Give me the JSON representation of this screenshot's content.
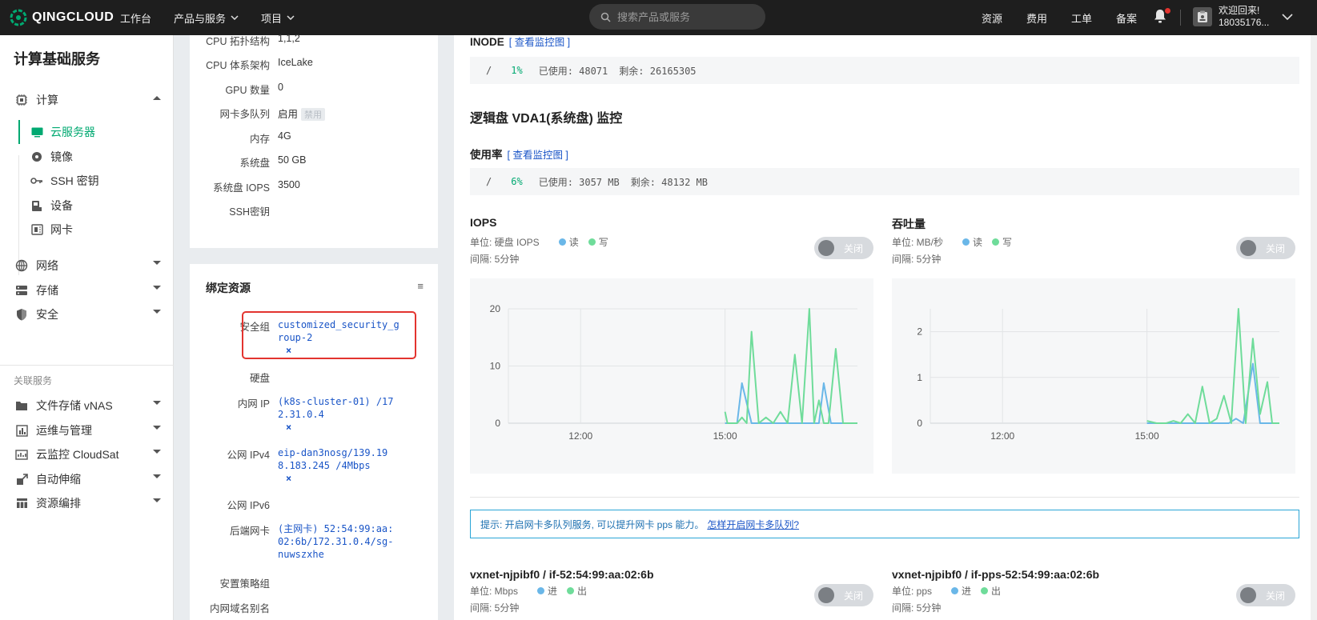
{
  "topbar": {
    "logo": "QINGCLOUD",
    "nav": [
      "工作台",
      "产品与服务",
      "项目"
    ],
    "search_placeholder": "搜索产品或服务",
    "right_nav": [
      "资源",
      "费用",
      "工单",
      "备案"
    ],
    "welcome": "欢迎回来!",
    "account": "18035176..."
  },
  "sidebar": {
    "title": "计算基础服务",
    "groups": {
      "compute": "计算",
      "network": "网络",
      "storage": "存储",
      "security": "安全"
    },
    "compute_items": [
      "云服务器",
      "镜像",
      "SSH 密钥",
      "设备",
      "网卡"
    ],
    "section_label": "关联服务",
    "related": [
      "文件存储 vNAS",
      "运维与管理",
      "云监控 CloudSat",
      "自动伸缩",
      "资源编排"
    ]
  },
  "spec": [
    {
      "k": "CPU 拓扑结构",
      "v": "1,1,2"
    },
    {
      "k": "CPU 体系架构",
      "v": "IceLake"
    },
    {
      "k": "GPU 数量",
      "v": "0"
    },
    {
      "k": "网卡多队列",
      "v": "启用",
      "tag": "禁用"
    },
    {
      "k": "内存",
      "v": "4G"
    },
    {
      "k": "系统盘",
      "v": "50 GB"
    },
    {
      "k": "系统盘 IOPS",
      "v": "3500"
    },
    {
      "k": "SSH密钥",
      "v": ""
    }
  ],
  "bound": {
    "title": "绑定资源",
    "menu": "≡",
    "security_group_k": "安全组",
    "security_group_v": "customized_security_group-2",
    "disk_k": "硬盘",
    "private_ip_k": "内网 IP",
    "private_ip_v": "(k8s-cluster-01) /172.31.0.4",
    "public_ipv4_k": "公网 IPv4",
    "public_ipv4_v": "eip-dan3nosg/139.198.183.245 /4Mbps",
    "public_ipv6_k": "公网 IPv6",
    "nic_k": "后端网卡",
    "nic_v": "(主网卡) 52:54:99:aa:02:6b/172.31.0.4/sg-nuwszxhe",
    "policy_k": "安置策略组",
    "dns_k": "内网域名别名",
    "remove": "×"
  },
  "main": {
    "inode_title": "INODE",
    "view_chart": "[ 查看监控图 ]",
    "inode_usage": {
      "path": "/",
      "pct": "1%",
      "used": "已使用: 48071",
      "free": "剩余: 26165305"
    },
    "disk_title": "逻辑盘 VDA1(系统盘) 监控",
    "usage_title": "使用率",
    "disk_usage": {
      "path": "/",
      "pct": "6%",
      "used": "已使用: 3057 MB",
      "free": "剩余: 48132 MB"
    },
    "toggle_label": "关闭",
    "interval": "间隔: 5分钟",
    "tip_text": "提示: 开启网卡多队列服务, 可以提升网卡 pps 能力。",
    "tip_link": "怎样开启网卡多队列?",
    "nic1_title": "vxnet-njpibf0 / if-52:54:99:aa:02:6b",
    "nic1_unit": "单位: Mbps",
    "nic2_title": "vxnet-njpibf0 / if-pps-52:54:99:aa:02:6b",
    "nic2_unit": "单位: pps",
    "legend_in": "进",
    "legend_out": "出"
  },
  "colors": {
    "read": "#6ab7e8",
    "write": "#6fdc9a",
    "accent": "#00a971"
  },
  "chart_data": [
    {
      "type": "line",
      "title": "IOPS",
      "unit": "单位: 硬盘 IOPS",
      "x_ticks": [
        "12:00",
        "15:00"
      ],
      "y_ticks": [
        0,
        10,
        20
      ],
      "ylim": [
        0,
        20
      ],
      "xlim": [
        10.5,
        17.75
      ],
      "series": [
        {
          "name": "读",
          "x": [
            15.0,
            15.15,
            15.25,
            15.35,
            15.55,
            15.7,
            15.85,
            16.0,
            16.3,
            16.5,
            16.6,
            16.7,
            16.85,
            16.95,
            17.05,
            17.2,
            17.4,
            17.6,
            17.75
          ],
          "y": [
            0,
            0,
            0,
            7,
            0,
            0,
            0,
            0,
            0,
            0,
            0,
            0,
            0,
            0,
            7,
            0,
            0,
            0,
            0
          ]
        },
        {
          "name": "写",
          "x": [
            15.0,
            15.05,
            15.25,
            15.35,
            15.45,
            15.55,
            15.7,
            15.85,
            16.0,
            16.15,
            16.3,
            16.45,
            16.6,
            16.75,
            16.85,
            16.95,
            17.05,
            17.15,
            17.3,
            17.45,
            17.6,
            17.75
          ],
          "y": [
            2,
            0,
            0,
            1,
            0,
            16,
            0,
            1,
            0,
            2,
            0,
            12,
            0,
            20,
            0,
            4,
            0,
            0,
            13,
            0,
            0,
            0
          ]
        }
      ]
    },
    {
      "type": "line",
      "title": "吞吐量",
      "unit": "单位: MB/秒",
      "x_ticks": [
        "12:00",
        "15:00"
      ],
      "y_ticks": [
        0,
        1,
        2
      ],
      "ylim": [
        0,
        2.5
      ],
      "xlim": [
        10.5,
        17.75
      ],
      "series": [
        {
          "name": "读",
          "x": [
            15.0,
            15.3,
            15.6,
            15.9,
            16.2,
            16.5,
            16.7,
            16.85,
            17.0,
            17.2,
            17.35,
            17.5,
            17.75
          ],
          "y": [
            0,
            0,
            0,
            0,
            0,
            0,
            0,
            0.1,
            0,
            1.3,
            0,
            0,
            0
          ]
        },
        {
          "name": "写",
          "x": [
            15.0,
            15.2,
            15.4,
            15.55,
            15.7,
            15.85,
            16.0,
            16.15,
            16.3,
            16.45,
            16.6,
            16.75,
            16.9,
            17.05,
            17.2,
            17.35,
            17.5,
            17.6,
            17.75
          ],
          "y": [
            0.05,
            0,
            0,
            0.05,
            0,
            0.2,
            0,
            0.8,
            0,
            0.1,
            0.6,
            0,
            2.5,
            0,
            1.85,
            0.2,
            0.9,
            0,
            0
          ]
        }
      ]
    }
  ]
}
